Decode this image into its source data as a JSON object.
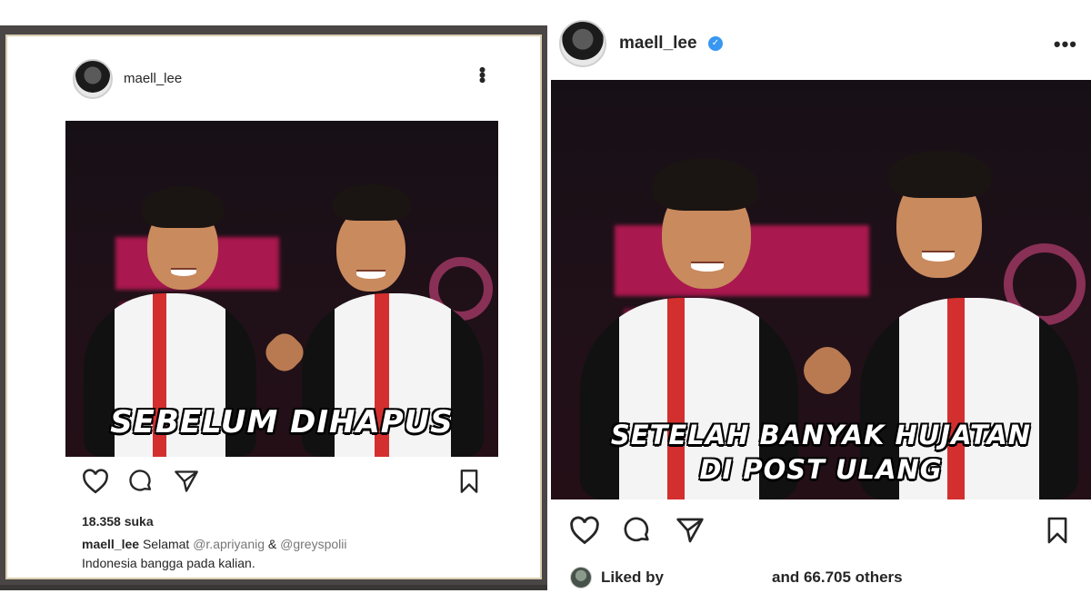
{
  "left_post": {
    "username": "maell_lee",
    "image_caption": "SEBELUM DIHAPUS",
    "likes": "18.358 suka",
    "caption": {
      "username": "maell_lee",
      "text_prefix": "Selamat",
      "mention1": "@r.apriyanig",
      "joiner": "&",
      "mention2": "@greyspolii",
      "line2": "Indonesia bangga pada kalian."
    },
    "icons": [
      "heart-icon",
      "comment-icon",
      "share-icon",
      "bookmark-icon"
    ]
  },
  "right_post": {
    "username": "maell_lee",
    "verified": true,
    "image_caption_line1": "SETELAH BANYAK HUJATAN",
    "image_caption_line2": "DI POST ULANG",
    "liked_by_label": "Liked by",
    "liked_others": "and 66.705 others",
    "icons": [
      "heart-icon",
      "comment-icon",
      "share-icon",
      "bookmark-icon"
    ]
  },
  "colors": {
    "verified_blue": "#3897f0",
    "text": "#262626",
    "frame_dark": "#4a4646",
    "frame_gold": "#d9ceb0",
    "backdrop_pink": "#d81b60"
  }
}
